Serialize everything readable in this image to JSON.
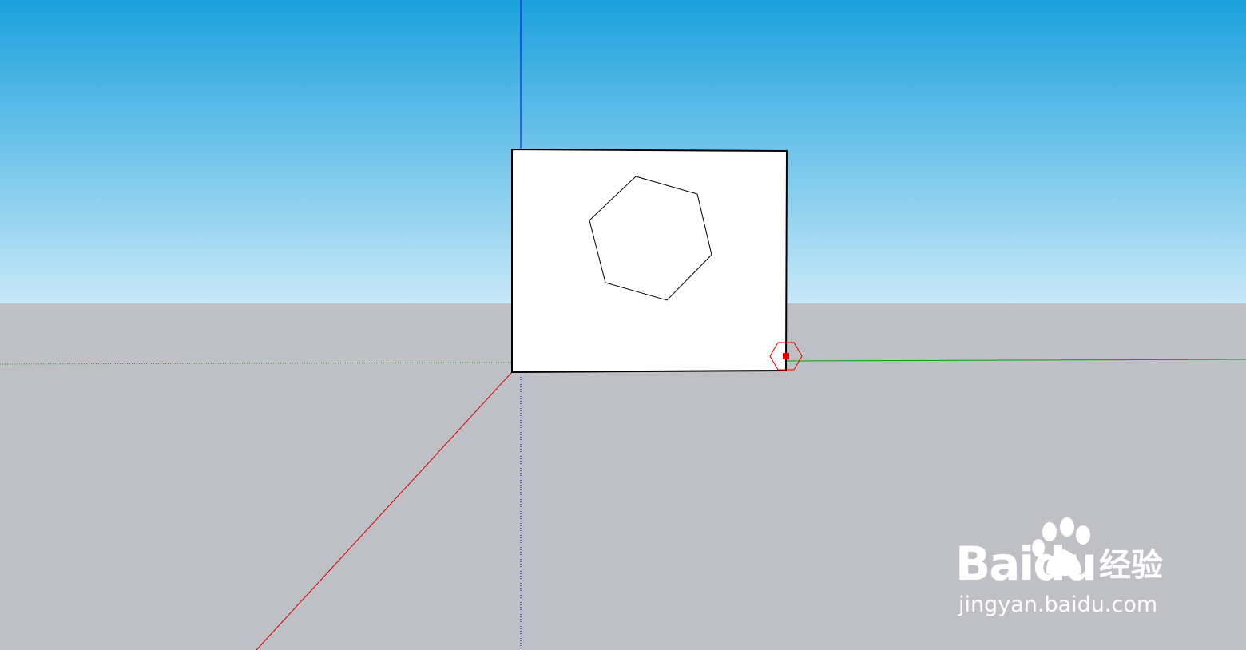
{
  "scene": {
    "colors": {
      "sky_top": "#1aa1dc",
      "sky_bottom": "#c8e8f8",
      "ground": "#bfc0c5",
      "axis_blue": "#0000ff",
      "axis_red": "#d00000",
      "axis_green": "#00a000",
      "face_fill": "#ffffff",
      "edge": "#000000",
      "cursor": "#e00000"
    },
    "objects": {
      "rectangle_face": "rectangle-face",
      "hexagon": "hexagon-outline",
      "cursor_marker": "hexagon-cursor-icon"
    }
  },
  "watermark": {
    "brand": "Bai",
    "brand_tail": "du",
    "chinese": "经验",
    "url": "jingyan.baidu.com",
    "icon": "baidu-paw-icon"
  }
}
